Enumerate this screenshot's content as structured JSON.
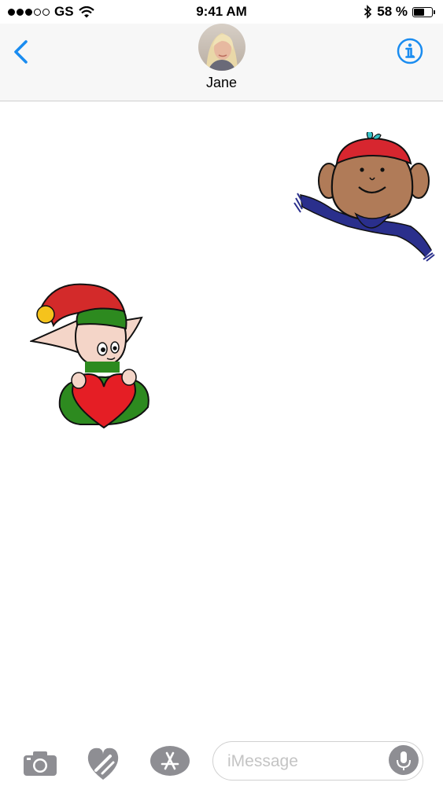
{
  "status_bar": {
    "carrier": "GS",
    "time": "9:41 AM",
    "battery_text": "58 %",
    "battery_level": 0.58,
    "signal_bars_filled": 3,
    "signal_bars_total": 5,
    "icons": [
      "wifi-icon",
      "bluetooth-icon",
      "battery-icon"
    ]
  },
  "header": {
    "contact_name": "Jane",
    "back_icon": "chevron-left-icon",
    "info_icon": "info-icon",
    "accent_color": "#1a8cf0"
  },
  "messages": [
    {
      "type": "sticker",
      "side": "right",
      "sticker": "boy-with-scarf"
    },
    {
      "type": "sticker",
      "side": "left",
      "sticker": "elf-with-heart"
    }
  ],
  "input_bar": {
    "placeholder": "iMessage",
    "icons": [
      "camera-icon",
      "digital-touch-icon",
      "app-store-icon",
      "microphone-icon"
    ]
  }
}
